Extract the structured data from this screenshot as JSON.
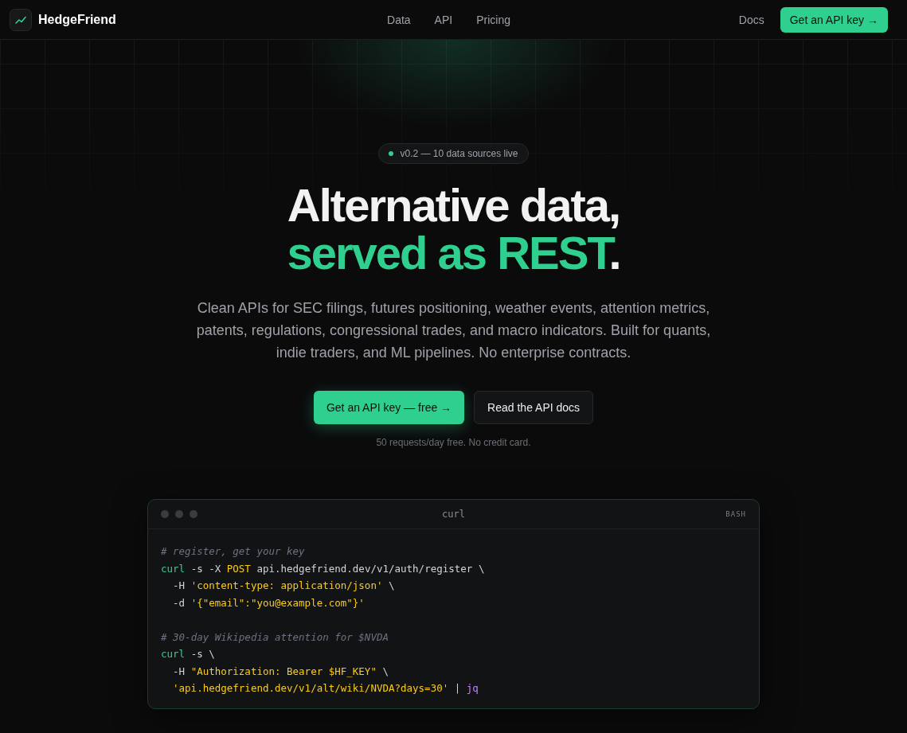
{
  "nav": {
    "brand": "HedgeFriend",
    "links": [
      {
        "label": "Data"
      },
      {
        "label": "API"
      },
      {
        "label": "Pricing"
      }
    ],
    "docs": "Docs",
    "cta": "Get an API key →"
  },
  "hero": {
    "badge": {
      "text": "v0.2 — 10 data sources live",
      "color": "#2fd08f"
    },
    "title_line1": "Alternative data,",
    "title_line2_accent": "served as REST",
    "title_line2_end": ".",
    "description": "Clean APIs for SEC filings, futures positioning, weather events, attention metrics, patents, regulations, congressional trades, and macro indicators. Built for quants, indie traders, and ML pipelines. No enterprise contracts.",
    "primary_button": "Get an API key — free →",
    "secondary_button": "Read the API docs",
    "note": "50 requests/day free. No credit card."
  },
  "code": {
    "title": "curl",
    "language": "BASH",
    "lines": [
      {
        "kind": "code",
        "tokens": [
          {
            "kind": "comment",
            "text": "# register, get your key"
          }
        ]
      },
      {
        "kind": "code",
        "tokens": [
          {
            "kind": "command",
            "text": "curl"
          },
          {
            "kind": "plain",
            "text": " -s -X "
          },
          {
            "kind": "keyword",
            "text": "POST"
          },
          {
            "kind": "plain",
            "text": " api.hedgefriend.dev/v1/auth/register \\"
          }
        ]
      },
      {
        "kind": "code",
        "indent": true,
        "tokens": [
          {
            "kind": "plain",
            "text": "-H "
          },
          {
            "kind": "string",
            "text": "'content-type: application/json'"
          },
          {
            "kind": "plain",
            "text": " \\"
          }
        ]
      },
      {
        "kind": "code",
        "indent": true,
        "tokens": [
          {
            "kind": "plain",
            "text": "-d "
          },
          {
            "kind": "string",
            "text": "'{\"email\":\"you@example.com\"}'"
          }
        ]
      },
      {
        "kind": "blank"
      },
      {
        "kind": "code",
        "tokens": [
          {
            "kind": "comment",
            "text": "# 30-day Wikipedia attention for $NVDA"
          }
        ]
      },
      {
        "kind": "code",
        "tokens": [
          {
            "kind": "command",
            "text": "curl"
          },
          {
            "kind": "plain",
            "text": " -s \\"
          }
        ]
      },
      {
        "kind": "code",
        "indent": true,
        "tokens": [
          {
            "kind": "plain",
            "text": "-H "
          },
          {
            "kind": "string",
            "text": "\"Authorization: Bearer $HF_KEY\""
          },
          {
            "kind": "plain",
            "text": " \\"
          }
        ]
      },
      {
        "kind": "code",
        "indent": true,
        "tokens": [
          {
            "kind": "string",
            "text": "'api.hedgefriend.dev/v1/alt/wiki/NVDA?days=30'"
          },
          {
            "kind": "plain",
            "text": " | "
          },
          {
            "kind": "tool",
            "text": "jq"
          }
        ]
      }
    ]
  }
}
